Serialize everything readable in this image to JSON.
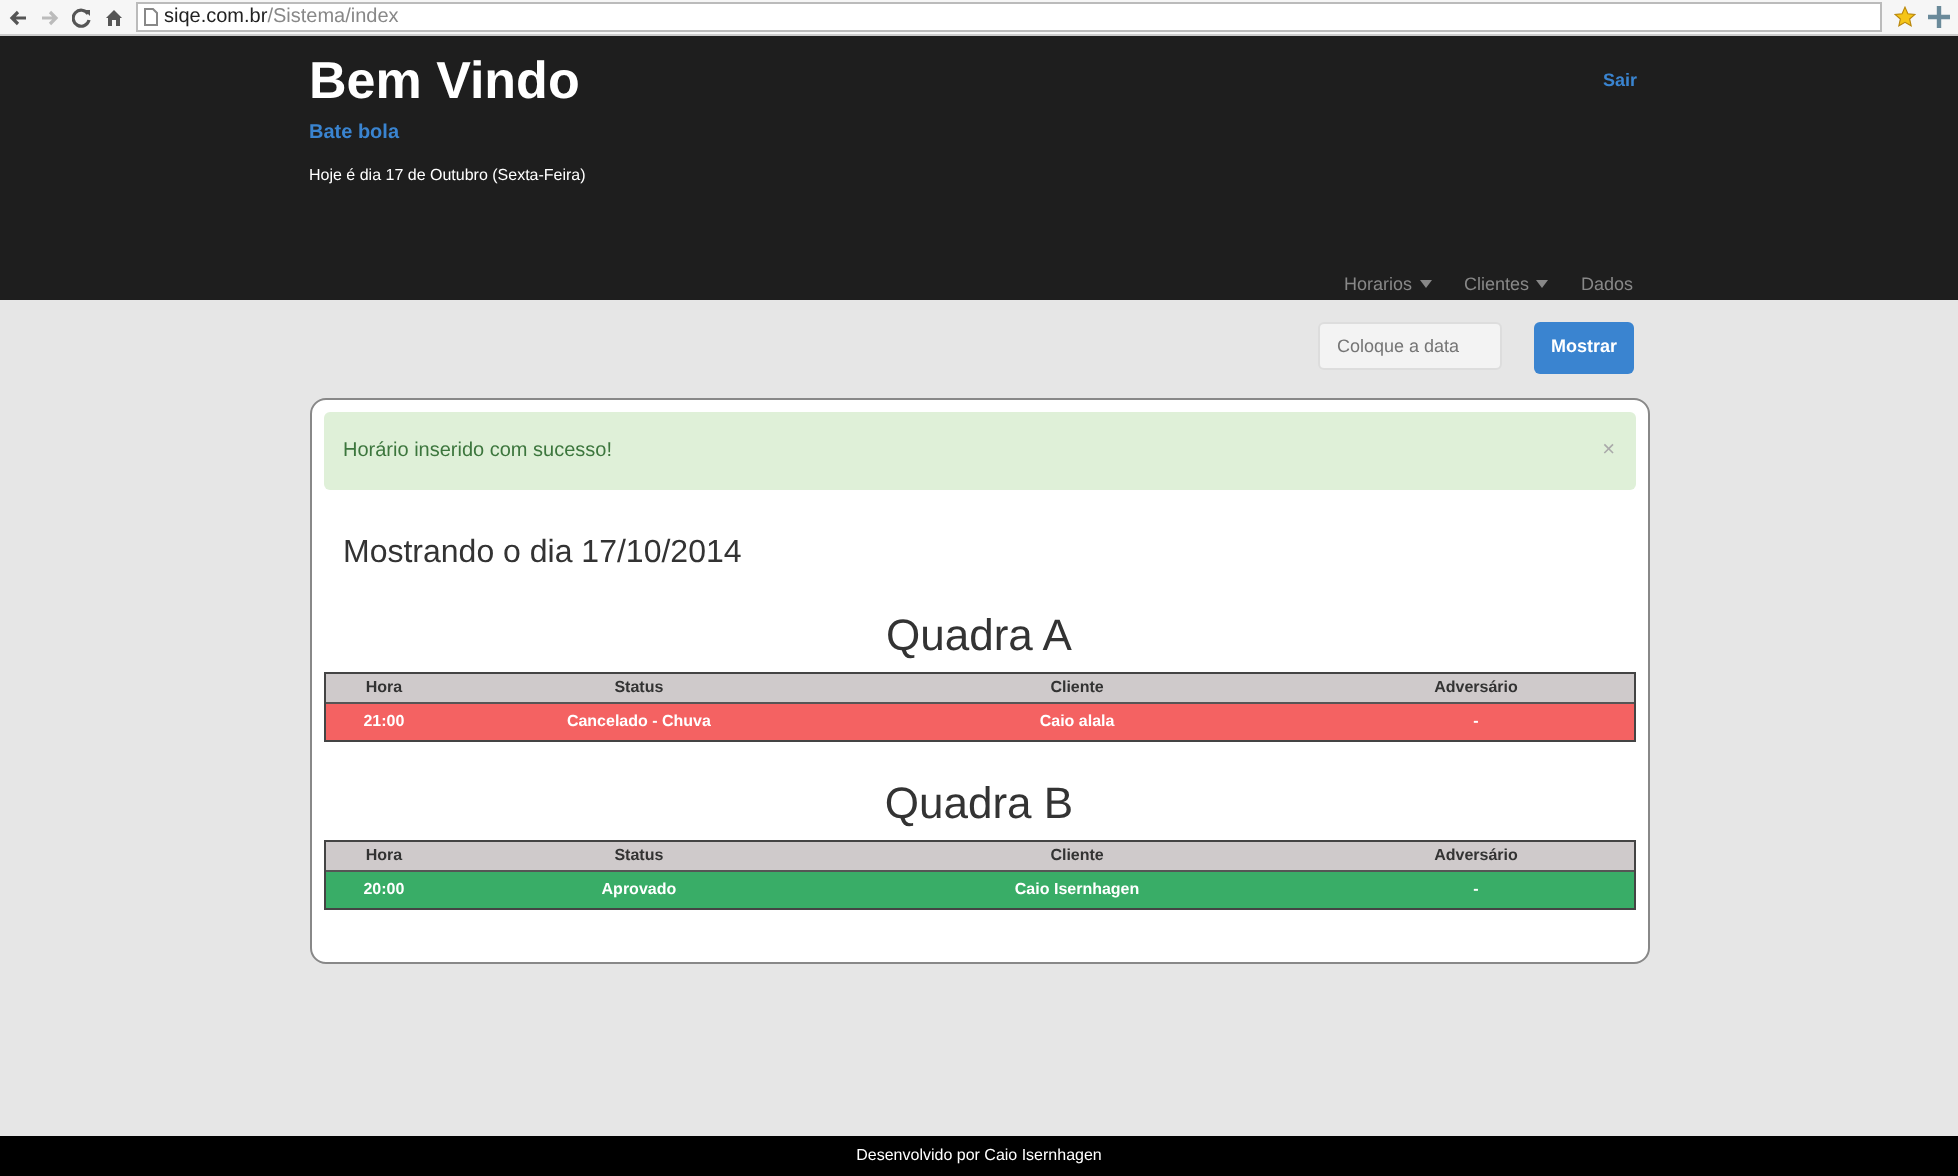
{
  "browser": {
    "url_domain": "siqe.com.br",
    "url_path": "/Sistema/index"
  },
  "header": {
    "title": "Bem Vindo",
    "subtitle": "Bate bola",
    "date_line": "Hoje é dia 17 de Outubro (Sexta-Feira)",
    "logout": "Sair",
    "nav": [
      {
        "label": "Horarios",
        "dropdown": true
      },
      {
        "label": "Clientes",
        "dropdown": true
      },
      {
        "label": "Dados",
        "dropdown": false
      }
    ]
  },
  "date_filter": {
    "placeholder": "Coloque a data",
    "button": "Mostrar"
  },
  "alert": {
    "message": "Horário inserido com sucesso!",
    "close": "×"
  },
  "heading": "Mostrando o dia 17/10/2014",
  "courts": [
    {
      "title": "Quadra A",
      "columns": [
        "Hora",
        "Status",
        "Cliente",
        "Adversário"
      ],
      "rows": [
        {
          "color": "#f46262",
          "cells": [
            "21:00",
            "Cancelado - Chuva",
            "Caio alala",
            "-"
          ]
        }
      ]
    },
    {
      "title": "Quadra B",
      "columns": [
        "Hora",
        "Status",
        "Cliente",
        "Adversário"
      ],
      "rows": [
        {
          "color": "#39ad67",
          "cells": [
            "20:00",
            "Aprovado",
            "Caio Isernhagen",
            "-"
          ]
        }
      ]
    }
  ],
  "footer": "Desenvolvido por Caio Isernhagen"
}
